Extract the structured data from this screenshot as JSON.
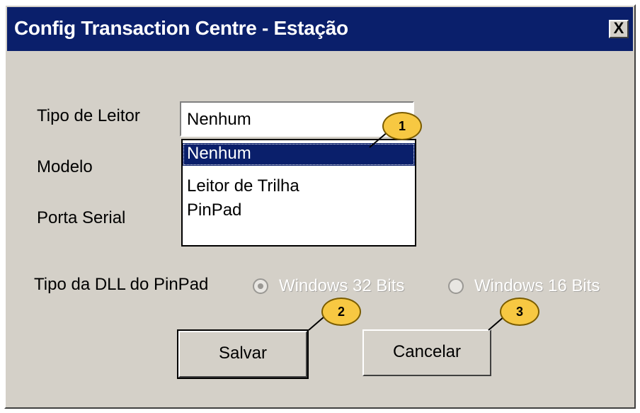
{
  "window": {
    "title": "Config Transaction Centre - Estação",
    "close_label": "X"
  },
  "form": {
    "tipo_leitor_label": "Tipo de Leitor",
    "modelo_label": "Modelo",
    "porta_serial_label": "Porta Serial",
    "dll_label": "Tipo da DLL  do PinPad",
    "combo_value": "Nenhum",
    "options": [
      "Nenhum",
      "Leitor de Trilha",
      "PinPad"
    ],
    "radio_32": "Windows 32 Bits",
    "radio_16": "Windows 16 Bits"
  },
  "buttons": {
    "save": "Salvar",
    "cancel": "Cancelar"
  },
  "callouts": [
    "1",
    "2",
    "3"
  ],
  "colors": {
    "titlebar": "#0a1f6b",
    "face": "#d4d0c8",
    "callout": "#f7c842"
  }
}
